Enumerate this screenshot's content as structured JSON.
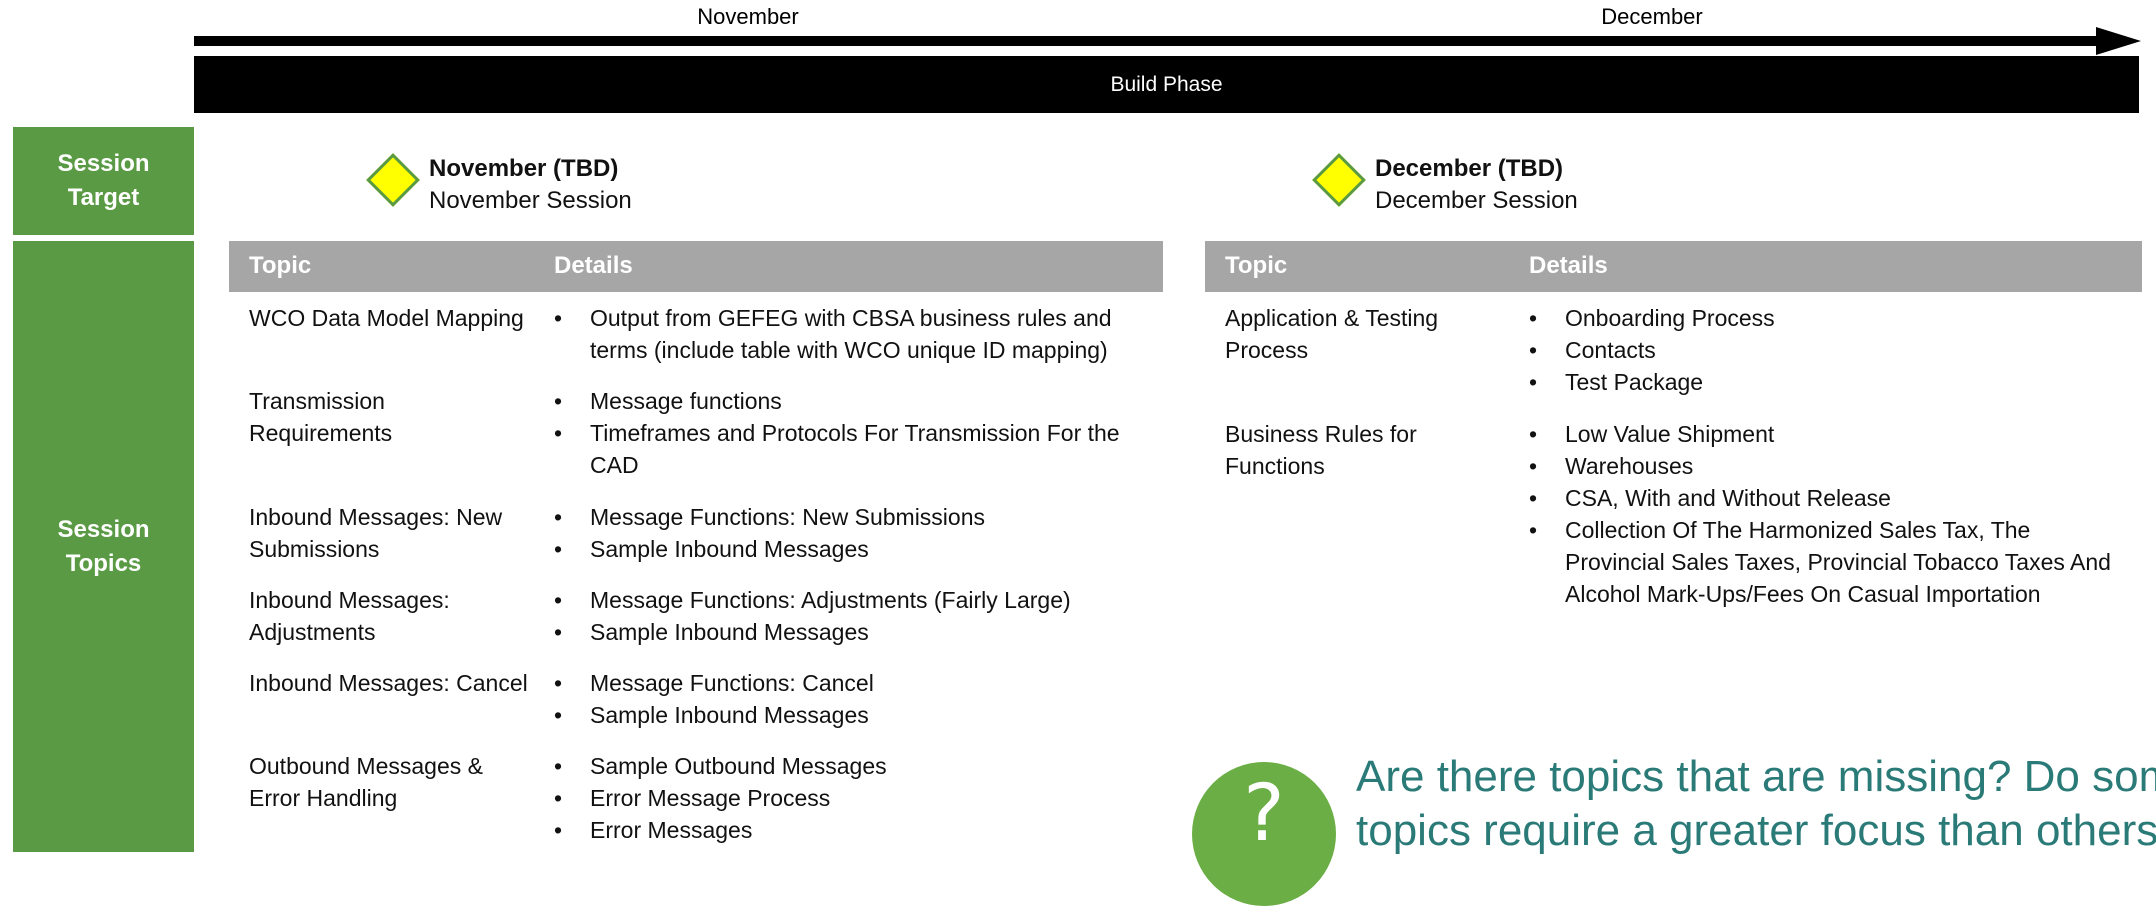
{
  "timeline": {
    "months": [
      "November",
      "December"
    ],
    "phase_label": "Build Phase"
  },
  "side_labels": {
    "session_target": "Session Target",
    "session_topics": "Session Topics"
  },
  "milestones": [
    {
      "title": "November (TBD)",
      "subtitle": "November Session"
    },
    {
      "title": "December (TBD)",
      "subtitle": "December Session"
    }
  ],
  "tables": {
    "headers": {
      "topic": "Topic",
      "details": "Details"
    },
    "november": [
      {
        "topic": "WCO Data Model Mapping",
        "details": [
          "Output from GEFEG with CBSA business rules and terms (include table with WCO unique ID mapping)"
        ]
      },
      {
        "topic": "Transmission Requirements",
        "details": [
          "Message functions",
          "Timeframes and Protocols For Transmission For the CAD"
        ]
      },
      {
        "topic": "Inbound Messages: New Submissions",
        "details": [
          "Message Functions: New Submissions",
          "Sample Inbound Messages"
        ]
      },
      {
        "topic": "Inbound Messages: Adjustments",
        "details": [
          "Message Functions: Adjustments (Fairly Large)",
          "Sample Inbound Messages"
        ]
      },
      {
        "topic": "Inbound Messages: Cancel",
        "details": [
          "Message Functions: Cancel",
          "Sample Inbound Messages"
        ]
      },
      {
        "topic": "Outbound Messages & Error Handling",
        "details": [
          "Sample Outbound Messages",
          "Error Message Process",
          "Error Messages"
        ]
      }
    ],
    "december": [
      {
        "topic": "Application & Testing Process",
        "details": [
          "Onboarding Process",
          "Contacts",
          "Test Package"
        ]
      },
      {
        "topic": "Business Rules for Functions",
        "details": [
          "Low Value Shipment",
          "Warehouses",
          "CSA, With and Without Release",
          "Collection Of The Harmonized Sales Tax, The Provincial Sales Taxes, Provincial Tobacco Taxes And Alcohol Mark-Ups/Fees On Casual Importation"
        ]
      }
    ]
  },
  "callout": {
    "icon": "question-icon",
    "line1": "Are there topics that are missing? Do som",
    "line2": "topics require a greater focus than others"
  },
  "colors": {
    "green": "#5a9a44",
    "header_gray": "#a6a6a6",
    "diamond_fill": "#ffff00",
    "callout_text": "#2a7a78"
  }
}
